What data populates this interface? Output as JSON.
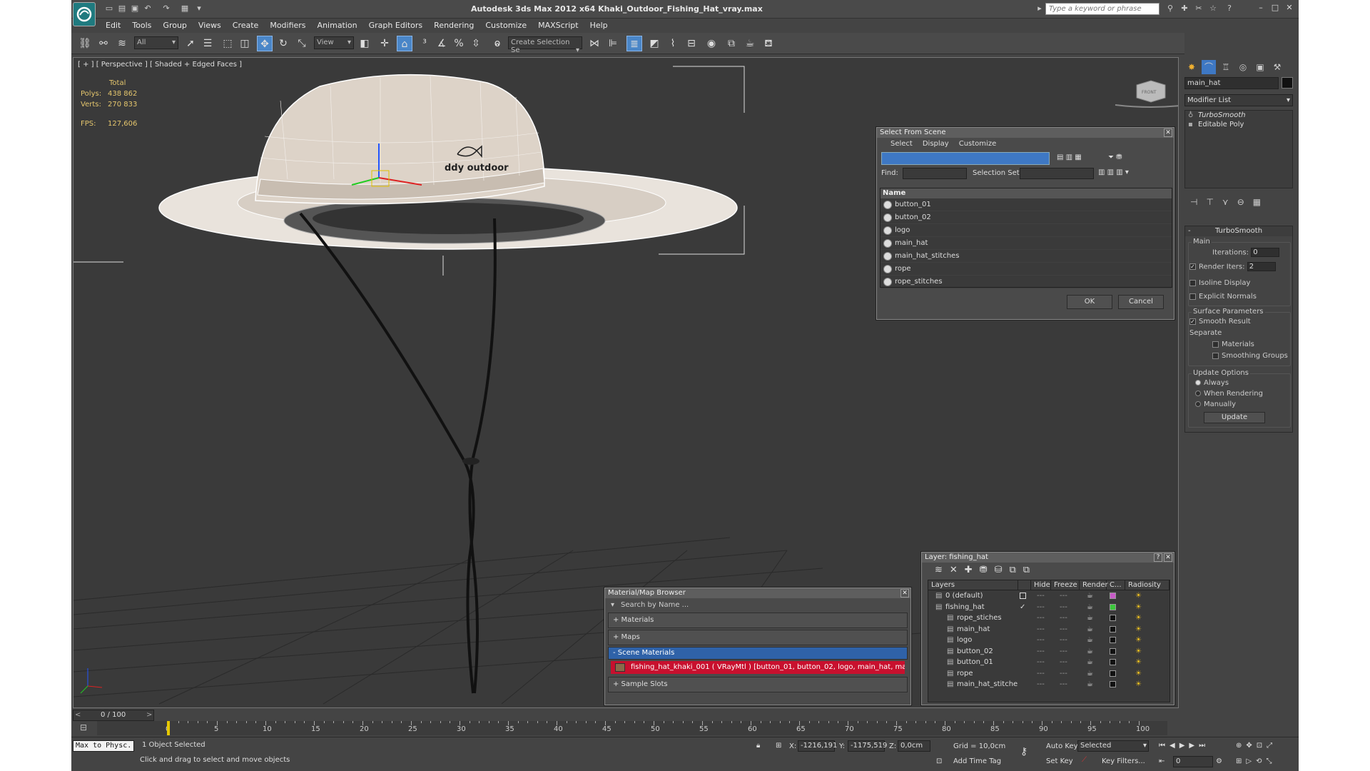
{
  "app": {
    "title": "Autodesk 3ds Max  2012 x64     Khaki_Outdoor_Fishing_Hat_vray.max",
    "search_placeholder": "Type a keyword or phrase"
  },
  "menu": [
    "Edit",
    "Tools",
    "Group",
    "Views",
    "Create",
    "Modifiers",
    "Animation",
    "Graph Editors",
    "Rendering",
    "Customize",
    "MAXScript",
    "Help"
  ],
  "toolbar": {
    "selection_filter": "All",
    "ref_coord": "View",
    "named_selection": "Create Selection Se"
  },
  "viewport": {
    "label": "[ + ] [ Perspective ] [ Shaded + Edged Faces ]",
    "stats": {
      "total_label": "Total",
      "polys_label": "Polys:",
      "polys": "438 862",
      "verts_label": "Verts:",
      "verts": "270 833",
      "fps_label": "FPS:",
      "fps": "127,606"
    },
    "cube_label": "FRONT",
    "hat_logo_text": "ddy outdoor"
  },
  "command_panel": {
    "object_name": "main_hat",
    "modifier_list": "Modifier List",
    "stack": [
      "TurboSmooth",
      "Editable Poly"
    ],
    "rollout_title": "TurboSmooth",
    "main_label": "Main",
    "iterations_label": "Iterations:",
    "iterations": "0",
    "render_iters_label": "Render Iters:",
    "render_iters": "2",
    "isoline": "Isoline Display",
    "explicit_normals": "Explicit Normals",
    "surface_params": "Surface Parameters",
    "smooth_result": "Smooth Result",
    "separate": "Separate",
    "materials": "Materials",
    "smoothing_groups": "Smoothing Groups",
    "update_options": "Update Options",
    "always": "Always",
    "when_rendering": "When Rendering",
    "manually": "Manually",
    "update_btn": "Update"
  },
  "select_dialog": {
    "title": "Select From Scene",
    "menu": [
      "Select",
      "Display",
      "Customize"
    ],
    "find_label": "Find:",
    "selection_set_label": "Selection Set:",
    "col_name": "Name",
    "items": [
      "button_01",
      "button_02",
      "logo",
      "main_hat",
      "main_hat_stitches",
      "rope",
      "rope_stitches"
    ],
    "ok": "OK",
    "cancel": "Cancel"
  },
  "material_browser": {
    "title": "Material/Map Browser",
    "search": "Search by Name ...",
    "sections": [
      "+ Materials",
      "+ Maps",
      "- Scene Materials",
      "+ Sample Slots"
    ],
    "material_item": "fishing_hat_khaki_001  ( VRayMtl )  [button_01, button_02, logo, main_hat, mai..."
  },
  "layer_dialog": {
    "title": "Layer: fishing_hat",
    "columns": [
      "Layers",
      "Hide",
      "Freeze",
      "Render",
      "C...",
      "Radiosity"
    ],
    "rows": [
      {
        "name": "0 (default)",
        "indent": 1,
        "color": "#c85ac8"
      },
      {
        "name": "fishing_hat",
        "indent": 1,
        "color": "#3cc83c"
      },
      {
        "name": "rope_stiches",
        "indent": 2,
        "color": "#111111"
      },
      {
        "name": "main_hat",
        "indent": 2,
        "color": "#111111"
      },
      {
        "name": "logo",
        "indent": 2,
        "color": "#111111"
      },
      {
        "name": "button_02",
        "indent": 2,
        "color": "#111111"
      },
      {
        "name": "button_01",
        "indent": 2,
        "color": "#111111"
      },
      {
        "name": "rope",
        "indent": 2,
        "color": "#111111"
      },
      {
        "name": "main_hat_stitche",
        "indent": 2,
        "color": "#111111"
      }
    ]
  },
  "timeline": {
    "frame": "0 / 100",
    "ticks": [
      "0",
      "5",
      "10",
      "15",
      "20",
      "25",
      "30",
      "35",
      "40",
      "45",
      "50",
      "55",
      "60",
      "65",
      "70",
      "75",
      "80",
      "85",
      "90",
      "95",
      "100"
    ]
  },
  "status": {
    "script": "Max to Physc.",
    "selected": "1 Object Selected",
    "prompt": "Click and drag to select and move objects",
    "x_label": "X:",
    "x": "-1216,191",
    "y_label": "Y:",
    "y": "-1175,519",
    "z_label": "Z:",
    "z": "0,0cm",
    "grid": "Grid = 10,0cm",
    "add_time_tag": "Add Time Tag",
    "auto_key": "Auto Key",
    "set_key": "Set Key",
    "selected_dd": "Selected",
    "key_filters": "Key Filters...",
    "frame_field": "0"
  }
}
